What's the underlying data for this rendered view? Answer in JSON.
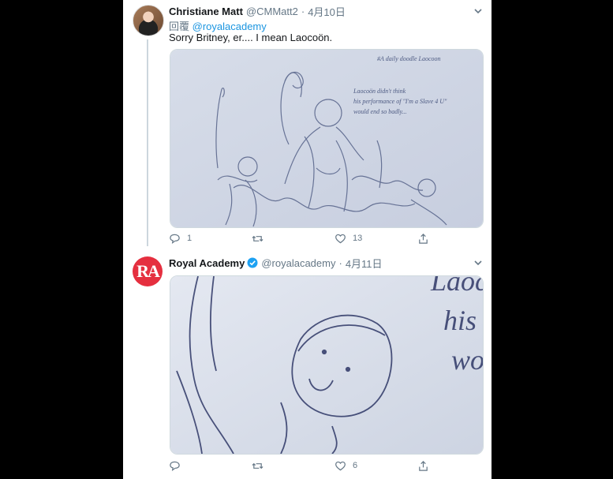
{
  "tweets": [
    {
      "name": "Christiane Matt",
      "handle": "@CMMatt2",
      "separator": "·",
      "date": "4月10日",
      "reply_prefix": "回覆",
      "reply_to": "@royalacademy",
      "text": "Sorry Britney, er.... I mean Laocoön.",
      "image_note_lines": [
        "#A daily doodle Laocoon",
        "Laocoön didn't think",
        "his performance of \"I'm a Slave 4 U\"",
        "would end so badly..."
      ],
      "actions": {
        "replies": "1",
        "retweets": "",
        "likes": "13"
      }
    },
    {
      "name": "Royal Academy",
      "handle": "@royalacademy",
      "separator": "·",
      "date": "4月11日",
      "avatar_text": "RA",
      "image_note_lines": [
        "Laoc",
        "his",
        "wo"
      ],
      "actions": {
        "replies": "",
        "retweets": "",
        "likes": "6"
      }
    }
  ],
  "colors": {
    "accent": "#1b95e0",
    "verified": "#1da1f2",
    "ra_brand": "#e52f3f",
    "muted": "#657786"
  },
  "icons": [
    "reply-icon",
    "retweet-icon",
    "like-icon",
    "share-icon",
    "chevron-down-icon",
    "verified-badge-icon"
  ]
}
